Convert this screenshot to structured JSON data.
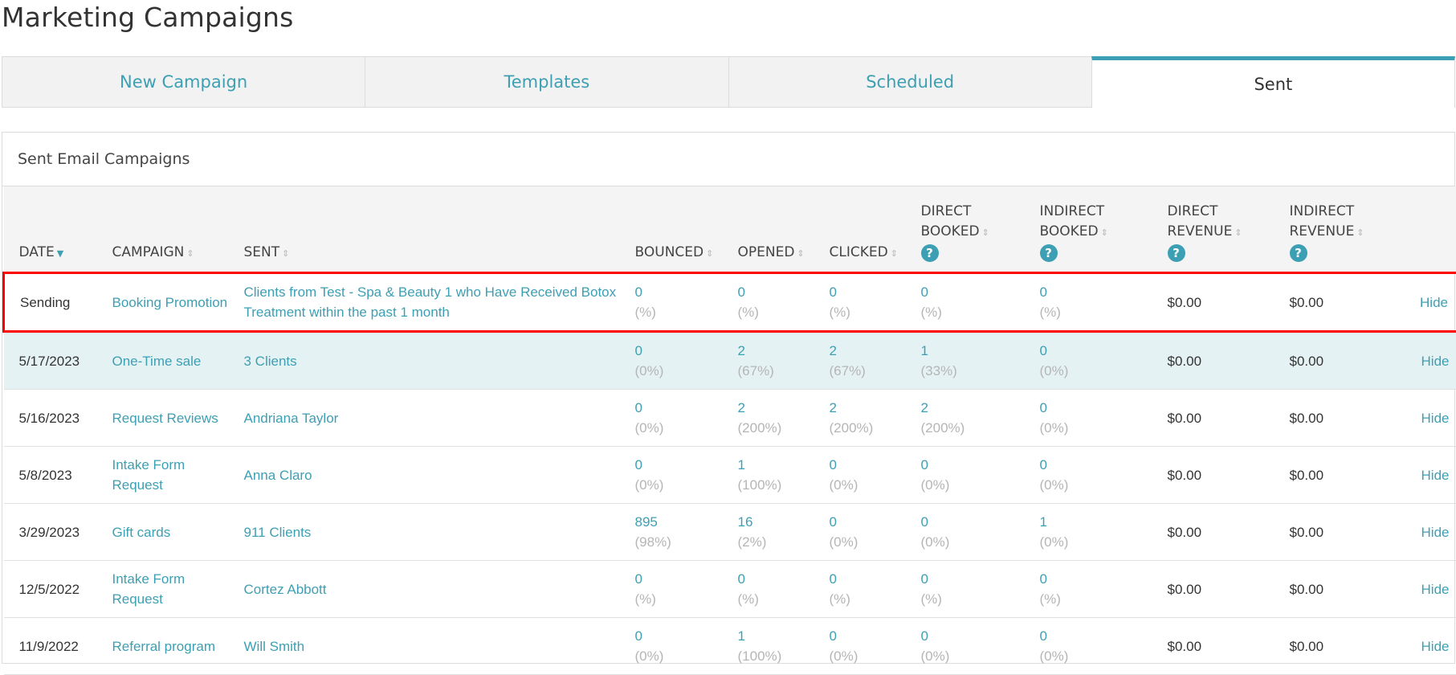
{
  "page": {
    "title": "Marketing Campaigns"
  },
  "tabs": [
    {
      "label": "New Campaign"
    },
    {
      "label": "Templates"
    },
    {
      "label": "Scheduled"
    },
    {
      "label": "Sent"
    }
  ],
  "panel": {
    "title": "Sent Email Campaigns"
  },
  "columns": {
    "date": "DATE",
    "campaign": "CAMPAIGN",
    "sent": "SENT",
    "bounced": "BOUNCED",
    "opened": "OPENED",
    "clicked": "CLICKED",
    "direct_booked": [
      "DIRECT",
      "BOOKED"
    ],
    "indirect_booked": [
      "INDIRECT",
      "BOOKED"
    ],
    "direct_revenue": [
      "DIRECT",
      "REVENUE"
    ],
    "indirect_revenue": [
      "INDIRECT",
      "REVENUE"
    ]
  },
  "icons": {
    "sort": "sort-arrows-icon",
    "sort_active": "caret-down-icon",
    "help": "question-circle-icon"
  },
  "help_glyph": "?",
  "colors": {
    "accent": "#3d9fb3",
    "highlight_row": "#e5f2f4",
    "selection_border": "#ff0000"
  },
  "rows": [
    {
      "date": "Sending",
      "campaign": "Booking Promotion",
      "sent": "Clients from Test - Spa & Beauty 1 who Have Received Botox Treatment within the past 1 month",
      "bounced": "0",
      "bounced_pct": "(%)",
      "opened": "0",
      "opened_pct": "(%)",
      "clicked": "0",
      "clicked_pct": "(%)",
      "direct_booked": "0",
      "direct_booked_pct": "(%)",
      "indirect_booked": "0",
      "indirect_booked_pct": "(%)",
      "direct_revenue": "$0.00",
      "indirect_revenue": "$0.00",
      "action": "Hide"
    },
    {
      "date": "5/17/2023",
      "campaign": "One-Time sale",
      "sent": "3 Clients",
      "bounced": "0",
      "bounced_pct": "(0%)",
      "opened": "2",
      "opened_pct": "(67%)",
      "clicked": "2",
      "clicked_pct": "(67%)",
      "direct_booked": "1",
      "direct_booked_pct": "(33%)",
      "indirect_booked": "0",
      "indirect_booked_pct": "(0%)",
      "direct_revenue": "$0.00",
      "indirect_revenue": "$0.00",
      "action": "Hide"
    },
    {
      "date": "5/16/2023",
      "campaign": "Request Reviews",
      "sent": "Andriana Taylor",
      "bounced": "0",
      "bounced_pct": "(0%)",
      "opened": "2",
      "opened_pct": "(200%)",
      "clicked": "2",
      "clicked_pct": "(200%)",
      "direct_booked": "2",
      "direct_booked_pct": "(200%)",
      "indirect_booked": "0",
      "indirect_booked_pct": "(0%)",
      "direct_revenue": "$0.00",
      "indirect_revenue": "$0.00",
      "action": "Hide"
    },
    {
      "date": "5/8/2023",
      "campaign": "Intake Form Request",
      "sent": "Anna Claro",
      "bounced": "0",
      "bounced_pct": "(0%)",
      "opened": "1",
      "opened_pct": "(100%)",
      "clicked": "0",
      "clicked_pct": "(0%)",
      "direct_booked": "0",
      "direct_booked_pct": "(0%)",
      "indirect_booked": "0",
      "indirect_booked_pct": "(0%)",
      "direct_revenue": "$0.00",
      "indirect_revenue": "$0.00",
      "action": "Hide"
    },
    {
      "date": "3/29/2023",
      "campaign": "Gift cards",
      "sent": "911 Clients",
      "bounced": "895",
      "bounced_pct": "(98%)",
      "opened": "16",
      "opened_pct": "(2%)",
      "clicked": "0",
      "clicked_pct": "(0%)",
      "direct_booked": "0",
      "direct_booked_pct": "(0%)",
      "indirect_booked": "1",
      "indirect_booked_pct": "(0%)",
      "direct_revenue": "$0.00",
      "indirect_revenue": "$0.00",
      "action": "Hide"
    },
    {
      "date": "12/5/2022",
      "campaign": "Intake Form Request",
      "sent": "Cortez Abbott",
      "bounced": "0",
      "bounced_pct": "(%)",
      "opened": "0",
      "opened_pct": "(%)",
      "clicked": "0",
      "clicked_pct": "(%)",
      "direct_booked": "0",
      "direct_booked_pct": "(%)",
      "indirect_booked": "0",
      "indirect_booked_pct": "(%)",
      "direct_revenue": "$0.00",
      "indirect_revenue": "$0.00",
      "action": "Hide"
    },
    {
      "date": "11/9/2022",
      "campaign": "Referral program",
      "sent": "Will Smith",
      "bounced": "0",
      "bounced_pct": "(0%)",
      "opened": "1",
      "opened_pct": "(100%)",
      "clicked": "0",
      "clicked_pct": "(0%)",
      "direct_booked": "0",
      "direct_booked_pct": "(0%)",
      "indirect_booked": "0",
      "indirect_booked_pct": "(0%)",
      "direct_revenue": "$0.00",
      "indirect_revenue": "$0.00",
      "action": "Hide"
    }
  ]
}
